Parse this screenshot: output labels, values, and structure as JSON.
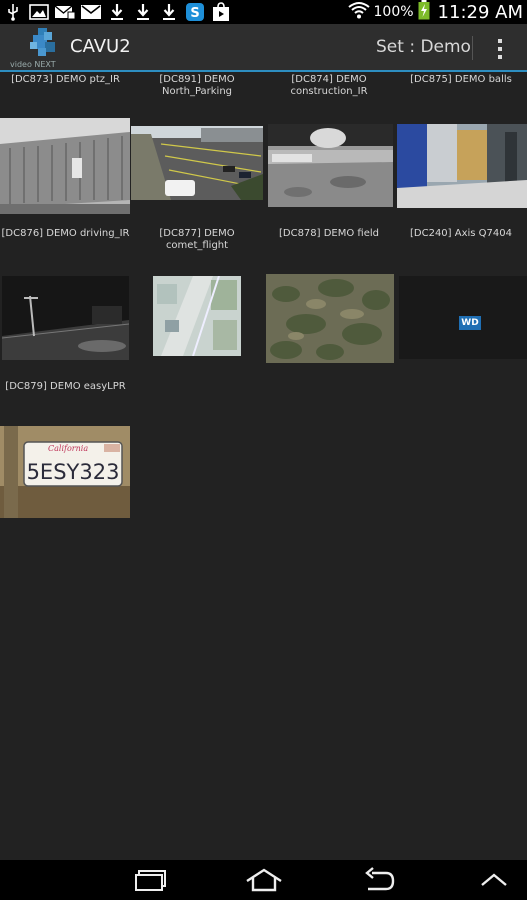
{
  "status_bar": {
    "icons": [
      "usb-icon",
      "image-icon",
      "email-icon",
      "gmail-icon",
      "download-icon",
      "download-icon",
      "download-icon",
      "skype-icon",
      "store-icon"
    ],
    "battery_percent": "100%",
    "time": "11:29 AM"
  },
  "action_bar": {
    "logo_text": "video NEXT",
    "title": "CAVU2",
    "set_label": "Set : Demo"
  },
  "cameras": [
    {
      "label": "[DC873] DEMO ptz_IR"
    },
    {
      "label": "[DC891] DEMO North_Parking"
    },
    {
      "label": "[DC874] DEMO construction_IR"
    },
    {
      "label": "[DC875] DEMO balls"
    },
    {
      "label": "[DC876] DEMO driving_IR"
    },
    {
      "label": "[DC877] DEMO comet_flight"
    },
    {
      "label": "[DC878] DEMO field"
    },
    {
      "label": "[DC240] Axis Q7404"
    },
    {
      "label": "[DC879] DEMO easyLPR"
    }
  ],
  "thumbnails": {
    "plate_text": "5ESY323",
    "plate_state": "California",
    "wd_text": "WD"
  },
  "nav_bar": {
    "icons": [
      "recent-apps-icon",
      "home-icon",
      "back-icon",
      "up-icon"
    ]
  }
}
